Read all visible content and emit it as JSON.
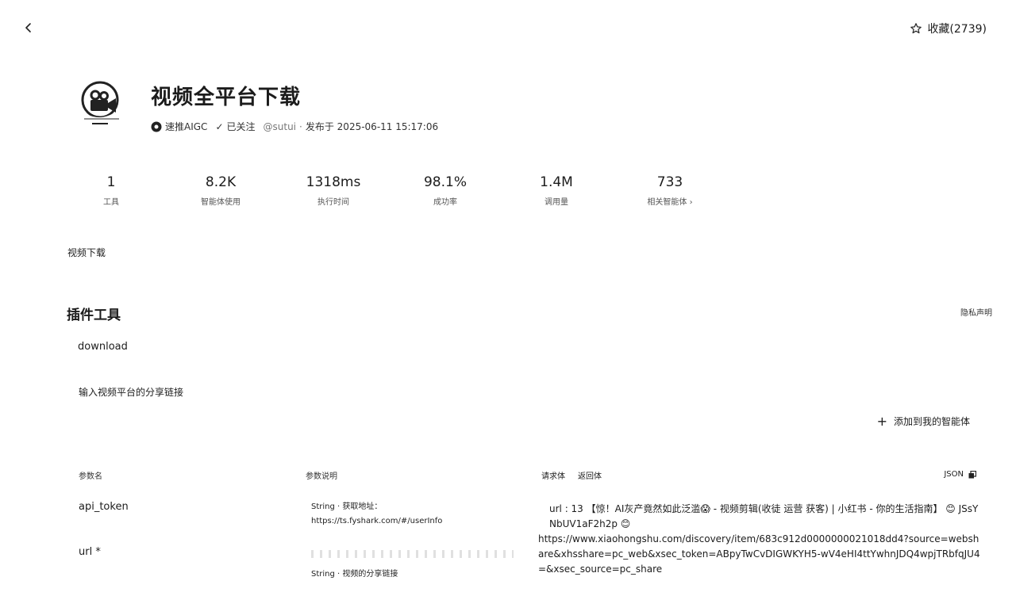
{
  "nav": {
    "back_icon": "chevron-left-icon"
  },
  "favorite": {
    "label": "收藏(2739)",
    "icon": "star-icon"
  },
  "plugin": {
    "title": "视频全平台下载",
    "author": "速推AIGC",
    "follow_label": "已关注",
    "handle": "@sutui",
    "separator": "·",
    "published": "发布于 2025-06-11 15:17:06"
  },
  "stats": [
    {
      "value": "1",
      "label": "工具"
    },
    {
      "value": "8.2K",
      "label": "智能体使用"
    },
    {
      "value": "1318ms",
      "label": "执行时间"
    },
    {
      "value": "98.1%",
      "label": "成功率"
    },
    {
      "value": "1.4M",
      "label": "调用量"
    },
    {
      "value": "733",
      "label": "相关智能体 ›"
    }
  ],
  "tag": "视频下载",
  "tools_section": {
    "title": "插件工具",
    "privacy_label": "隐私声明",
    "tool_name": "download",
    "tool_desc": "输入视频平台的分享链接",
    "add_label": "添加到我的智能体"
  },
  "params": {
    "headers": {
      "name": "参数名",
      "desc": "参数说明"
    },
    "tabs": {
      "request": "请求体",
      "response": "返回体"
    },
    "json_label": "JSON",
    "rows": [
      {
        "name": "api_token",
        "desc_line1": "String · 获取地址：",
        "desc_line2": "https://ts.fyshark.com/#/userInfo"
      },
      {
        "name": "url *",
        "desc_line1": "String · 视频的分享链接"
      }
    ]
  },
  "request_body": {
    "line1": "url : 13 【惊！AI灰产竟然如此泛滥😱 - 视频剪辑(收徒 运营 获客) | 小红书 - 你的生活指南】 😊 JSsYNbUV1aF2h2p 😊",
    "line2": "https://www.xiaohongshu.com/discovery/item/683c912d0000000021018dd4?source=webshare&xhsshare=pc_web&xsec_token=ABpyTwCvDIGWKYH5-wV4eHI4ttYwhnJDQ4wpjTRbfqJU4=&xsec_source=pc_share"
  }
}
